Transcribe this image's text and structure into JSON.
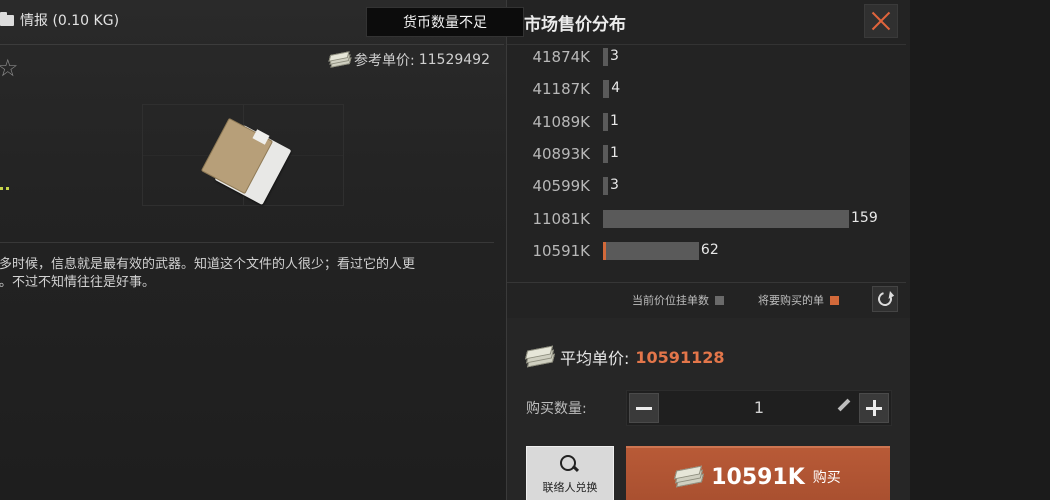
{
  "item": {
    "title": "情报 (0.10 KG)",
    "reference_price_label": "参考单价:",
    "reference_price_value": "11529492",
    "description_lines": [
      "很多时候，信息就是最有效的武器。知道这个文件的人很少；看过它的人更",
      "少。不过不知情往往是好事。"
    ]
  },
  "toast": {
    "text": "货币数量不足"
  },
  "market": {
    "title": "市场售价分布",
    "legend_current": "当前价位挂单数",
    "legend_buy": "将要购买的单",
    "colors": {
      "current": "#5a5a5a",
      "buy": "#d2693a",
      "accent": "#e3764a"
    }
  },
  "chart_data": {
    "type": "bar",
    "orientation": "horizontal",
    "categories": [
      "41874K",
      "41187K",
      "41089K",
      "40893K",
      "40599K",
      "11081K",
      "10591K"
    ],
    "values": [
      3,
      4,
      1,
      1,
      3,
      159,
      62
    ],
    "buying": [
      0,
      0,
      0,
      0,
      0,
      0,
      1
    ],
    "max": 159
  },
  "purchase": {
    "avg_label": "平均单价:",
    "avg_value": "10591128",
    "qty_label": "购买数量:",
    "qty_value": "1",
    "contact_label": "联络人兑换",
    "buy_price": "10591K",
    "buy_label": "购买"
  },
  "icons": [
    "folder-icon",
    "star-icon",
    "cash-icon",
    "document-icon",
    "close-icon",
    "refresh-icon",
    "minus-icon",
    "plus-icon",
    "pencil-icon",
    "magnifier-icon"
  ]
}
